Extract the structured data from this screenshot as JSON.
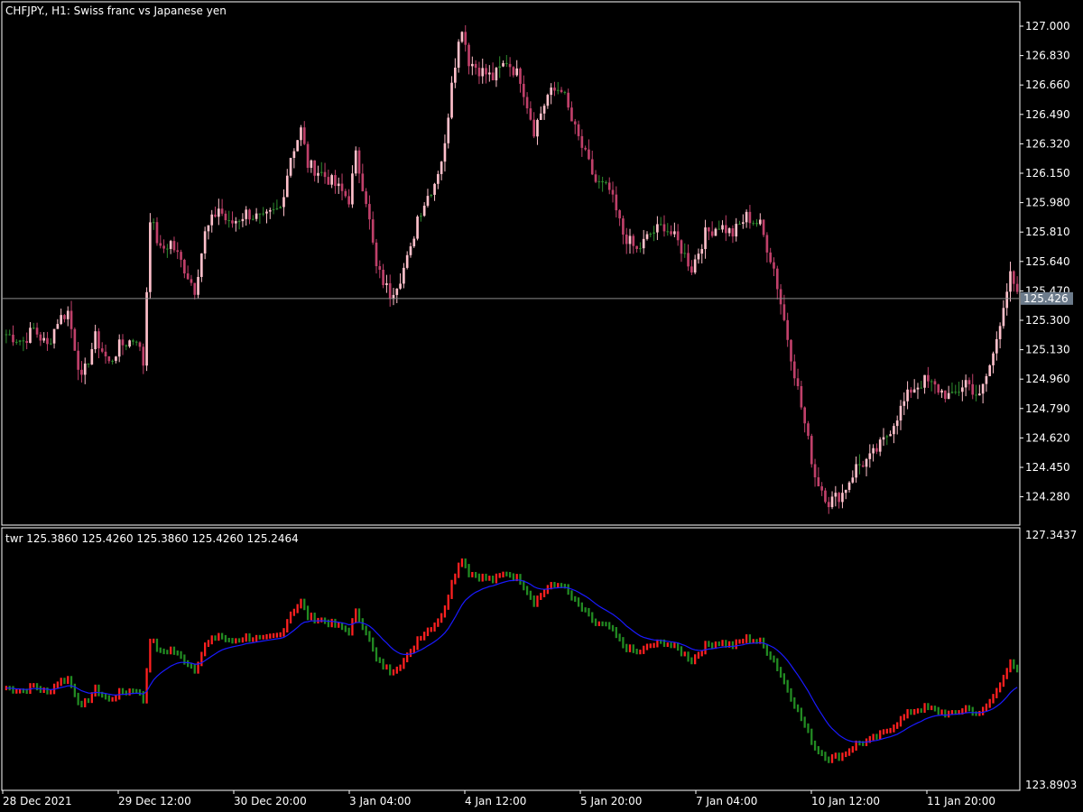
{
  "window_title": "CHFJPY., H1:  Swiss franc vs Japanese yen",
  "main": {
    "price_ticks": [
      "127.000",
      "126.830",
      "126.660",
      "126.490",
      "126.320",
      "126.150",
      "125.980",
      "125.810",
      "125.640",
      "125.470",
      "125.300",
      "125.130",
      "124.960",
      "124.790",
      "124.620",
      "124.450",
      "124.280"
    ],
    "current_price": "125.426",
    "price_range": [
      124.19,
      127.27
    ]
  },
  "indicator": {
    "label": "twr 125.3860 125.4260 125.3860 125.4260 125.2464",
    "scale_max": "127.3437",
    "scale_min": "123.8903"
  },
  "time_axis": [
    "28 Dec 2021",
    "29 Dec 12:00",
    "30 Dec 20:00",
    "3 Jan 04:00",
    "4 Jan 12:00",
    "5 Jan 20:00",
    "7 Jan 04:00",
    "10 Jan 12:00",
    "11 Jan 20:00"
  ],
  "colors": {
    "background": "#000000",
    "grid_border": "#ffffff",
    "bull_candle": "#ffc0cb",
    "bear_candle": "#c0406a",
    "doji": "#2e8b2e",
    "indicator_up": "#ff2020",
    "indicator_down": "#228b22",
    "indicator_ma": "#1a1aff",
    "price_tag_bg": "#6c7b8b"
  },
  "chart_data": {
    "type": "candlestick",
    "symbol": "CHFJPY.",
    "timeframe": "H1",
    "close_path": [
      [
        0,
        125.22
      ],
      [
        5,
        125.18
      ],
      [
        8,
        125.25
      ],
      [
        12,
        125.15
      ],
      [
        15,
        125.3
      ],
      [
        18,
        125.35
      ],
      [
        22,
        124.95
      ],
      [
        26,
        125.2
      ],
      [
        30,
        125.05
      ],
      [
        33,
        125.15
      ],
      [
        38,
        125.2
      ],
      [
        40,
        125.05
      ],
      [
        42,
        125.9
      ],
      [
        45,
        125.7
      ],
      [
        48,
        125.75
      ],
      [
        52,
        125.6
      ],
      [
        55,
        125.48
      ],
      [
        58,
        125.8
      ],
      [
        62,
        125.95
      ],
      [
        65,
        125.85
      ],
      [
        70,
        125.92
      ],
      [
        75,
        125.88
      ],
      [
        80,
        125.95
      ],
      [
        83,
        126.25
      ],
      [
        86,
        126.4
      ],
      [
        88,
        126.2
      ],
      [
        92,
        126.15
      ],
      [
        95,
        126.1
      ],
      [
        100,
        126.0
      ],
      [
        102,
        126.25
      ],
      [
        105,
        126.0
      ],
      [
        108,
        125.6
      ],
      [
        112,
        125.45
      ],
      [
        115,
        125.55
      ],
      [
        118,
        125.7
      ],
      [
        120,
        125.9
      ],
      [
        125,
        126.1
      ],
      [
        128,
        126.3
      ],
      [
        130,
        126.7
      ],
      [
        133,
        127.0
      ],
      [
        135,
        126.8
      ],
      [
        138,
        126.75
      ],
      [
        142,
        126.7
      ],
      [
        146,
        126.8
      ],
      [
        150,
        126.7
      ],
      [
        154,
        126.4
      ],
      [
        158,
        126.6
      ],
      [
        162,
        126.65
      ],
      [
        165,
        126.45
      ],
      [
        168,
        126.3
      ],
      [
        172,
        126.1
      ],
      [
        176,
        126.05
      ],
      [
        180,
        125.8
      ],
      [
        184,
        125.7
      ],
      [
        188,
        125.8
      ],
      [
        192,
        125.85
      ],
      [
        196,
        125.75
      ],
      [
        200,
        125.6
      ],
      [
        204,
        125.8
      ],
      [
        208,
        125.85
      ],
      [
        212,
        125.8
      ],
      [
        216,
        125.9
      ],
      [
        220,
        125.85
      ],
      [
        224,
        125.6
      ],
      [
        228,
        125.2
      ],
      [
        232,
        124.8
      ],
      [
        236,
        124.4
      ],
      [
        240,
        124.25
      ],
      [
        244,
        124.3
      ],
      [
        248,
        124.45
      ],
      [
        252,
        124.5
      ],
      [
        256,
        124.6
      ],
      [
        260,
        124.75
      ],
      [
        264,
        124.9
      ],
      [
        268,
        124.95
      ],
      [
        272,
        124.9
      ],
      [
        276,
        124.85
      ],
      [
        280,
        124.95
      ],
      [
        284,
        124.85
      ],
      [
        288,
        125.1
      ],
      [
        291,
        125.4
      ],
      [
        293,
        125.55
      ],
      [
        295,
        125.43
      ]
    ]
  }
}
